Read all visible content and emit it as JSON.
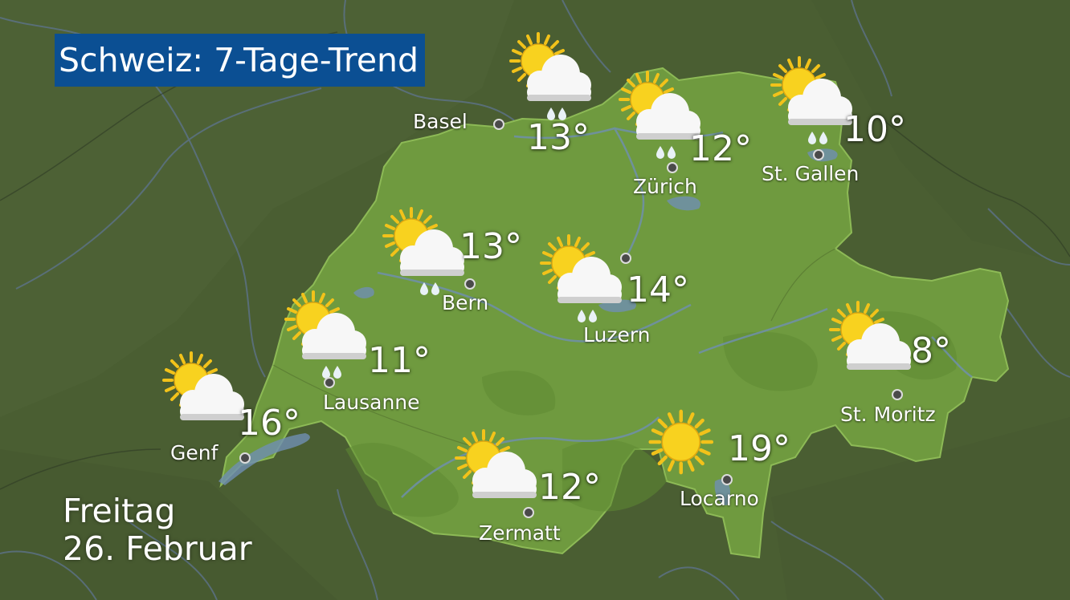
{
  "title": "Schweiz: 7-Tage-Trend",
  "date": {
    "day": "Freitag",
    "date": "26. Februar"
  },
  "colors": {
    "title_bg": "#0b4f93",
    "land_ch": "#6f9a3f",
    "land_outside": "#4a5e32"
  },
  "cities": [
    {
      "id": "basel",
      "name": "Basel",
      "temp": "13°",
      "icon": "sun-cloud-rain-icon"
    },
    {
      "id": "zuerich",
      "name": "Zürich",
      "temp": "12°",
      "icon": "sun-cloud-rain-icon"
    },
    {
      "id": "st-gallen",
      "name": "St. Gallen",
      "temp": "10°",
      "icon": "sun-cloud-rain-icon"
    },
    {
      "id": "bern",
      "name": "Bern",
      "temp": "13°",
      "icon": "sun-cloud-rain-icon"
    },
    {
      "id": "luzern",
      "name": "Luzern",
      "temp": "14°",
      "icon": "sun-cloud-rain-icon"
    },
    {
      "id": "lausanne",
      "name": "Lausanne",
      "temp": "11°",
      "icon": "sun-cloud-rain-icon"
    },
    {
      "id": "genf",
      "name": "Genf",
      "temp": "16°",
      "icon": "sun-cloud-icon"
    },
    {
      "id": "zermatt",
      "name": "Zermatt",
      "temp": "12°",
      "icon": "sun-cloud-icon"
    },
    {
      "id": "locarno",
      "name": "Locarno",
      "temp": "19°",
      "icon": "sun-icon"
    },
    {
      "id": "st-moritz",
      "name": "St. Moritz",
      "temp": "8°",
      "icon": "sun-cloud-icon"
    }
  ]
}
